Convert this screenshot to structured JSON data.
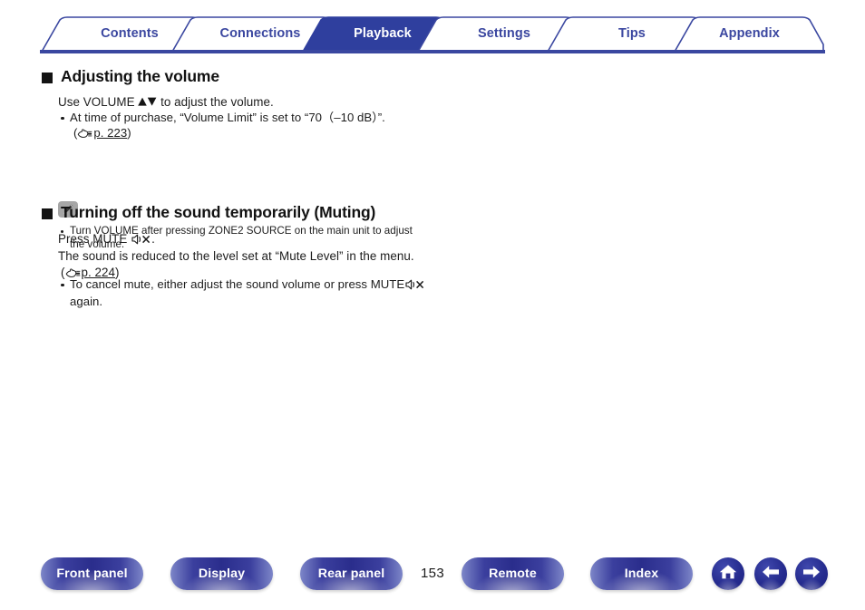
{
  "tabs": [
    {
      "label": "Contents",
      "active": false
    },
    {
      "label": "Connections",
      "active": false
    },
    {
      "label": "Playback",
      "active": true
    },
    {
      "label": "Settings",
      "active": false
    },
    {
      "label": "Tips",
      "active": false
    },
    {
      "label": "Appendix",
      "active": false
    }
  ],
  "colors": {
    "tab_border": "#3a47a0",
    "tab_text": "#3b47a0",
    "tab_active_fill": "#2f3f9e",
    "tab_active_text": "#ffffff",
    "rule": "#3a47a0",
    "body_text": "#1c1c1c",
    "button_blue": "#2a2d8c"
  },
  "sections": [
    {
      "heading": "Adjusting the volume",
      "intro_before_arrows": "Use VOLUME ",
      "intro_after_arrows": " to adjust the volume.",
      "bullets": [
        {
          "text": "At time of purchase, “Volume Limit” is set to “70（–10 dB）”.",
          "xref_open": "(",
          "xref_page": "p. 223",
          "xref_close": ")"
        }
      ],
      "note": {
        "icon": "pencil-icon",
        "bullets": [
          "Turn VOLUME after pressing ZONE2 SOURCE on the main unit to adjust the volume."
        ]
      }
    },
    {
      "heading": "Turning off the sound temporarily (Muting)",
      "press_label": "Press MUTE",
      "press_suffix": ".",
      "description": "The sound is reduced to the level set at “Mute Level” in the menu.",
      "xref_open": "(",
      "xref_page": "p. 224",
      "xref_close": ")",
      "bullets": [
        {
          "text_before_glyph": "To cancel mute, either adjust the sound volume or press MUTE",
          "text_after_glyph": "again."
        }
      ]
    }
  ],
  "footer": {
    "buttons": [
      {
        "label": "Front panel"
      },
      {
        "label": "Display"
      },
      {
        "label": "Rear panel"
      },
      {
        "label": "Remote"
      },
      {
        "label": "Index"
      }
    ],
    "page_number": "153",
    "icon_buttons": [
      {
        "name": "home-icon"
      },
      {
        "name": "arrow-left-icon"
      },
      {
        "name": "arrow-right-icon"
      }
    ]
  }
}
